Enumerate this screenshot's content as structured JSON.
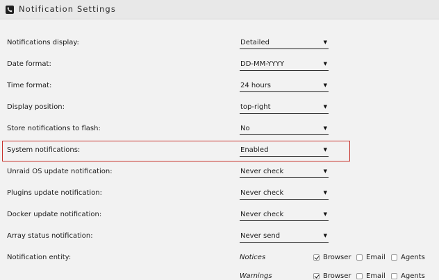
{
  "header": {
    "title": "Notification Settings",
    "icon": "phone-icon"
  },
  "settings": [
    {
      "label": "Notifications display:",
      "value": "Detailed"
    },
    {
      "label": "Date format:",
      "value": "DD-MM-YYYY"
    },
    {
      "label": "Time format:",
      "value": "24 hours"
    },
    {
      "label": "Display position:",
      "value": "top-right"
    },
    {
      "label": "Store notifications to flash:",
      "value": "No"
    },
    {
      "label": "System notifications:",
      "value": "Enabled"
    },
    {
      "label": "Unraid OS update notification:",
      "value": "Never check"
    },
    {
      "label": "Plugins update notification:",
      "value": "Never check"
    },
    {
      "label": "Docker update notification:",
      "value": "Never check"
    },
    {
      "label": "Array status notification:",
      "value": "Never send"
    }
  ],
  "entity": {
    "label": "Notification entity:",
    "rows": [
      {
        "name": "Notices",
        "options": [
          {
            "label": "Browser",
            "checked": true
          },
          {
            "label": "Email",
            "checked": false
          },
          {
            "label": "Agents",
            "checked": false
          }
        ]
      },
      {
        "name": "Warnings",
        "options": [
          {
            "label": "Browser",
            "checked": true
          },
          {
            "label": "Email",
            "checked": false
          },
          {
            "label": "Agents",
            "checked": false
          }
        ]
      }
    ]
  },
  "highlight_color": "#c7322b"
}
